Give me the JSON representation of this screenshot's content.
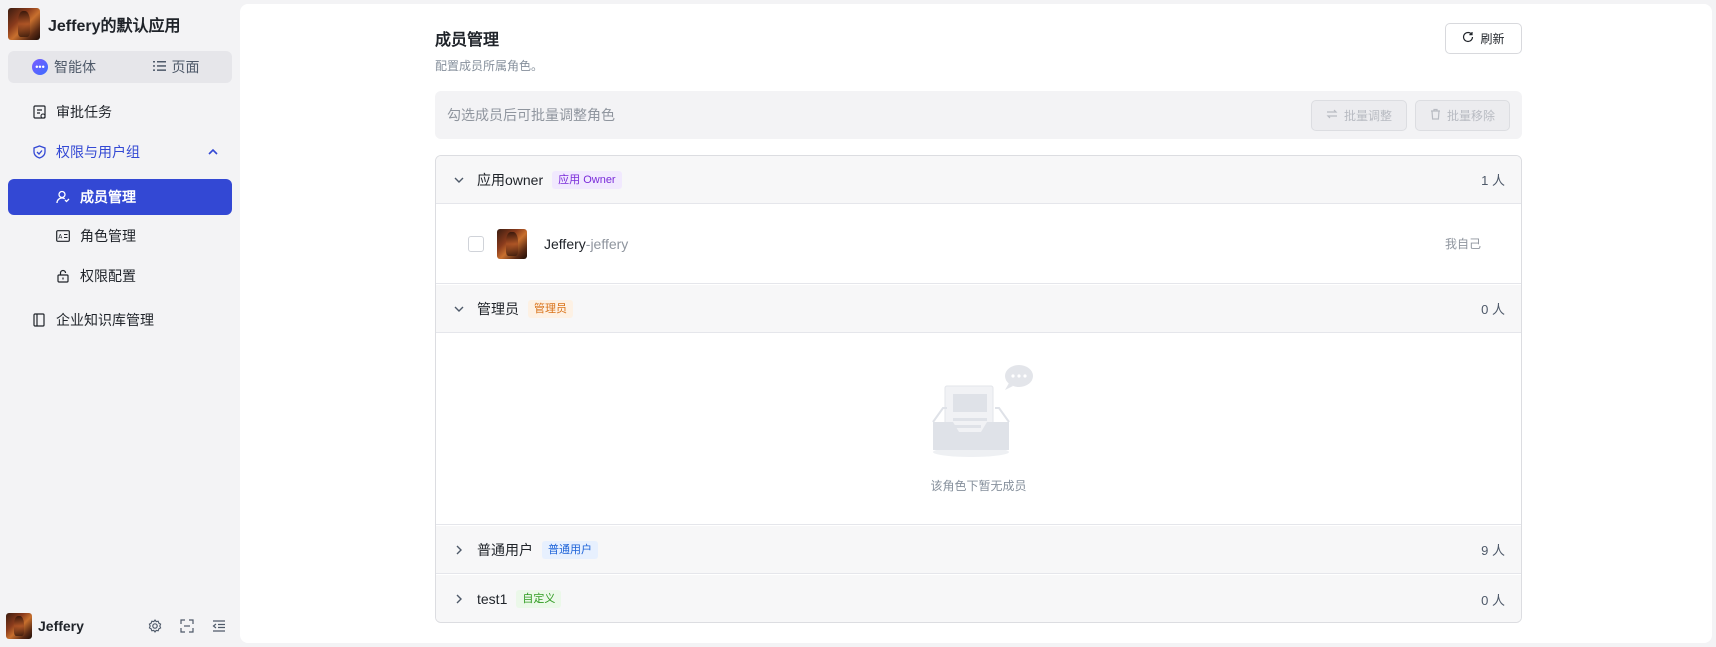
{
  "app": {
    "title": "Jeffery的默认应用"
  },
  "switcher": {
    "agent_label": "智能体",
    "page_label": "页面"
  },
  "nav": {
    "approval": "审批任务",
    "permissions_group": "权限与用户组",
    "members": "成员管理",
    "roles": "角色管理",
    "permission_config": "权限配置",
    "knowledge": "企业知识库管理"
  },
  "user": {
    "name": "Jeffery"
  },
  "page": {
    "title": "成员管理",
    "description": "配置成员所属角色。",
    "refresh_label": "刷新"
  },
  "batch": {
    "hint": "勾选成员后可批量调整角色",
    "adjust_label": "批量调整",
    "remove_label": "批量移除"
  },
  "roles": [
    {
      "name": "应用owner",
      "tag": "应用 Owner",
      "count": "1 人",
      "expanded": true,
      "members": [
        {
          "display_name": "Jeffery",
          "separator": " - ",
          "username": "jeffery",
          "note": "我自己"
        }
      ]
    },
    {
      "name": "管理员",
      "tag": "管理员",
      "count": "0 人",
      "expanded": true,
      "empty_text": "该角色下暂无成员"
    },
    {
      "name": "普通用户",
      "tag": "普通用户",
      "count": "9 人",
      "expanded": false
    },
    {
      "name": "test1",
      "tag": "自定义",
      "count": "0 人",
      "expanded": false
    }
  ],
  "colors": {
    "accent": "#3348d4",
    "tag_owner": "#7a2bd9",
    "tag_admin": "#d9731a",
    "tag_user": "#1e63d8",
    "tag_custom": "#2f9b21"
  }
}
